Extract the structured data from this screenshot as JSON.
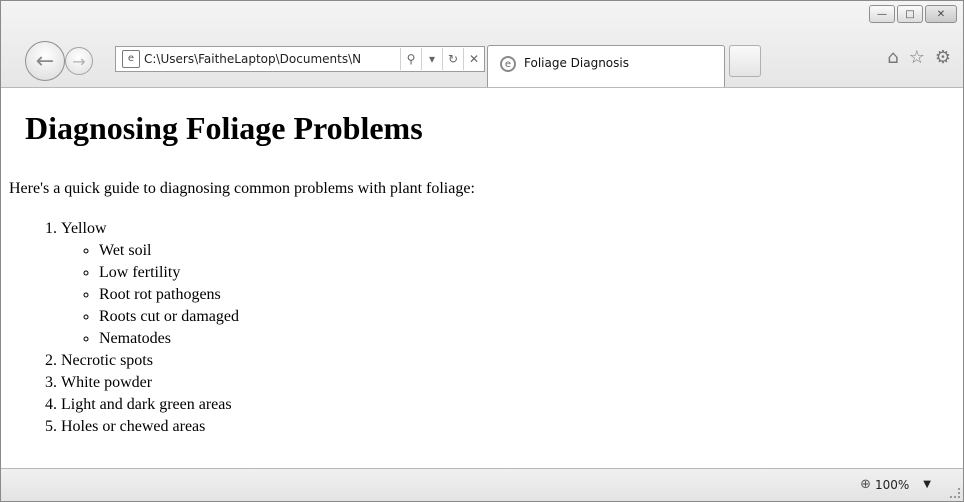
{
  "browser": {
    "address_url": "C:\\Users\\FaitheLaptop\\Documents\\N",
    "tab_title": "Foliage Diagnosis",
    "zoom": "100%",
    "icons": {
      "back": "back-arrow-icon",
      "forward": "forward-arrow-icon",
      "search": "search-icon",
      "refresh": "refresh-icon",
      "stop": "stop-icon",
      "home": "home-icon",
      "favorites": "star-icon",
      "tools": "gear-icon"
    }
  },
  "page": {
    "heading": "Diagnosing Foliage Problems",
    "intro": "Here's a quick guide to diagnosing common problems with plant foliage:",
    "list": [
      {
        "label": "Yellow",
        "children": [
          "Wet soil",
          "Low fertility",
          "Root rot pathogens",
          "Roots cut or damaged",
          "Nematodes"
        ]
      },
      {
        "label": "Necrotic spots"
      },
      {
        "label": "White powder"
      },
      {
        "label": "Light and dark green areas"
      },
      {
        "label": "Holes or chewed areas"
      }
    ]
  }
}
